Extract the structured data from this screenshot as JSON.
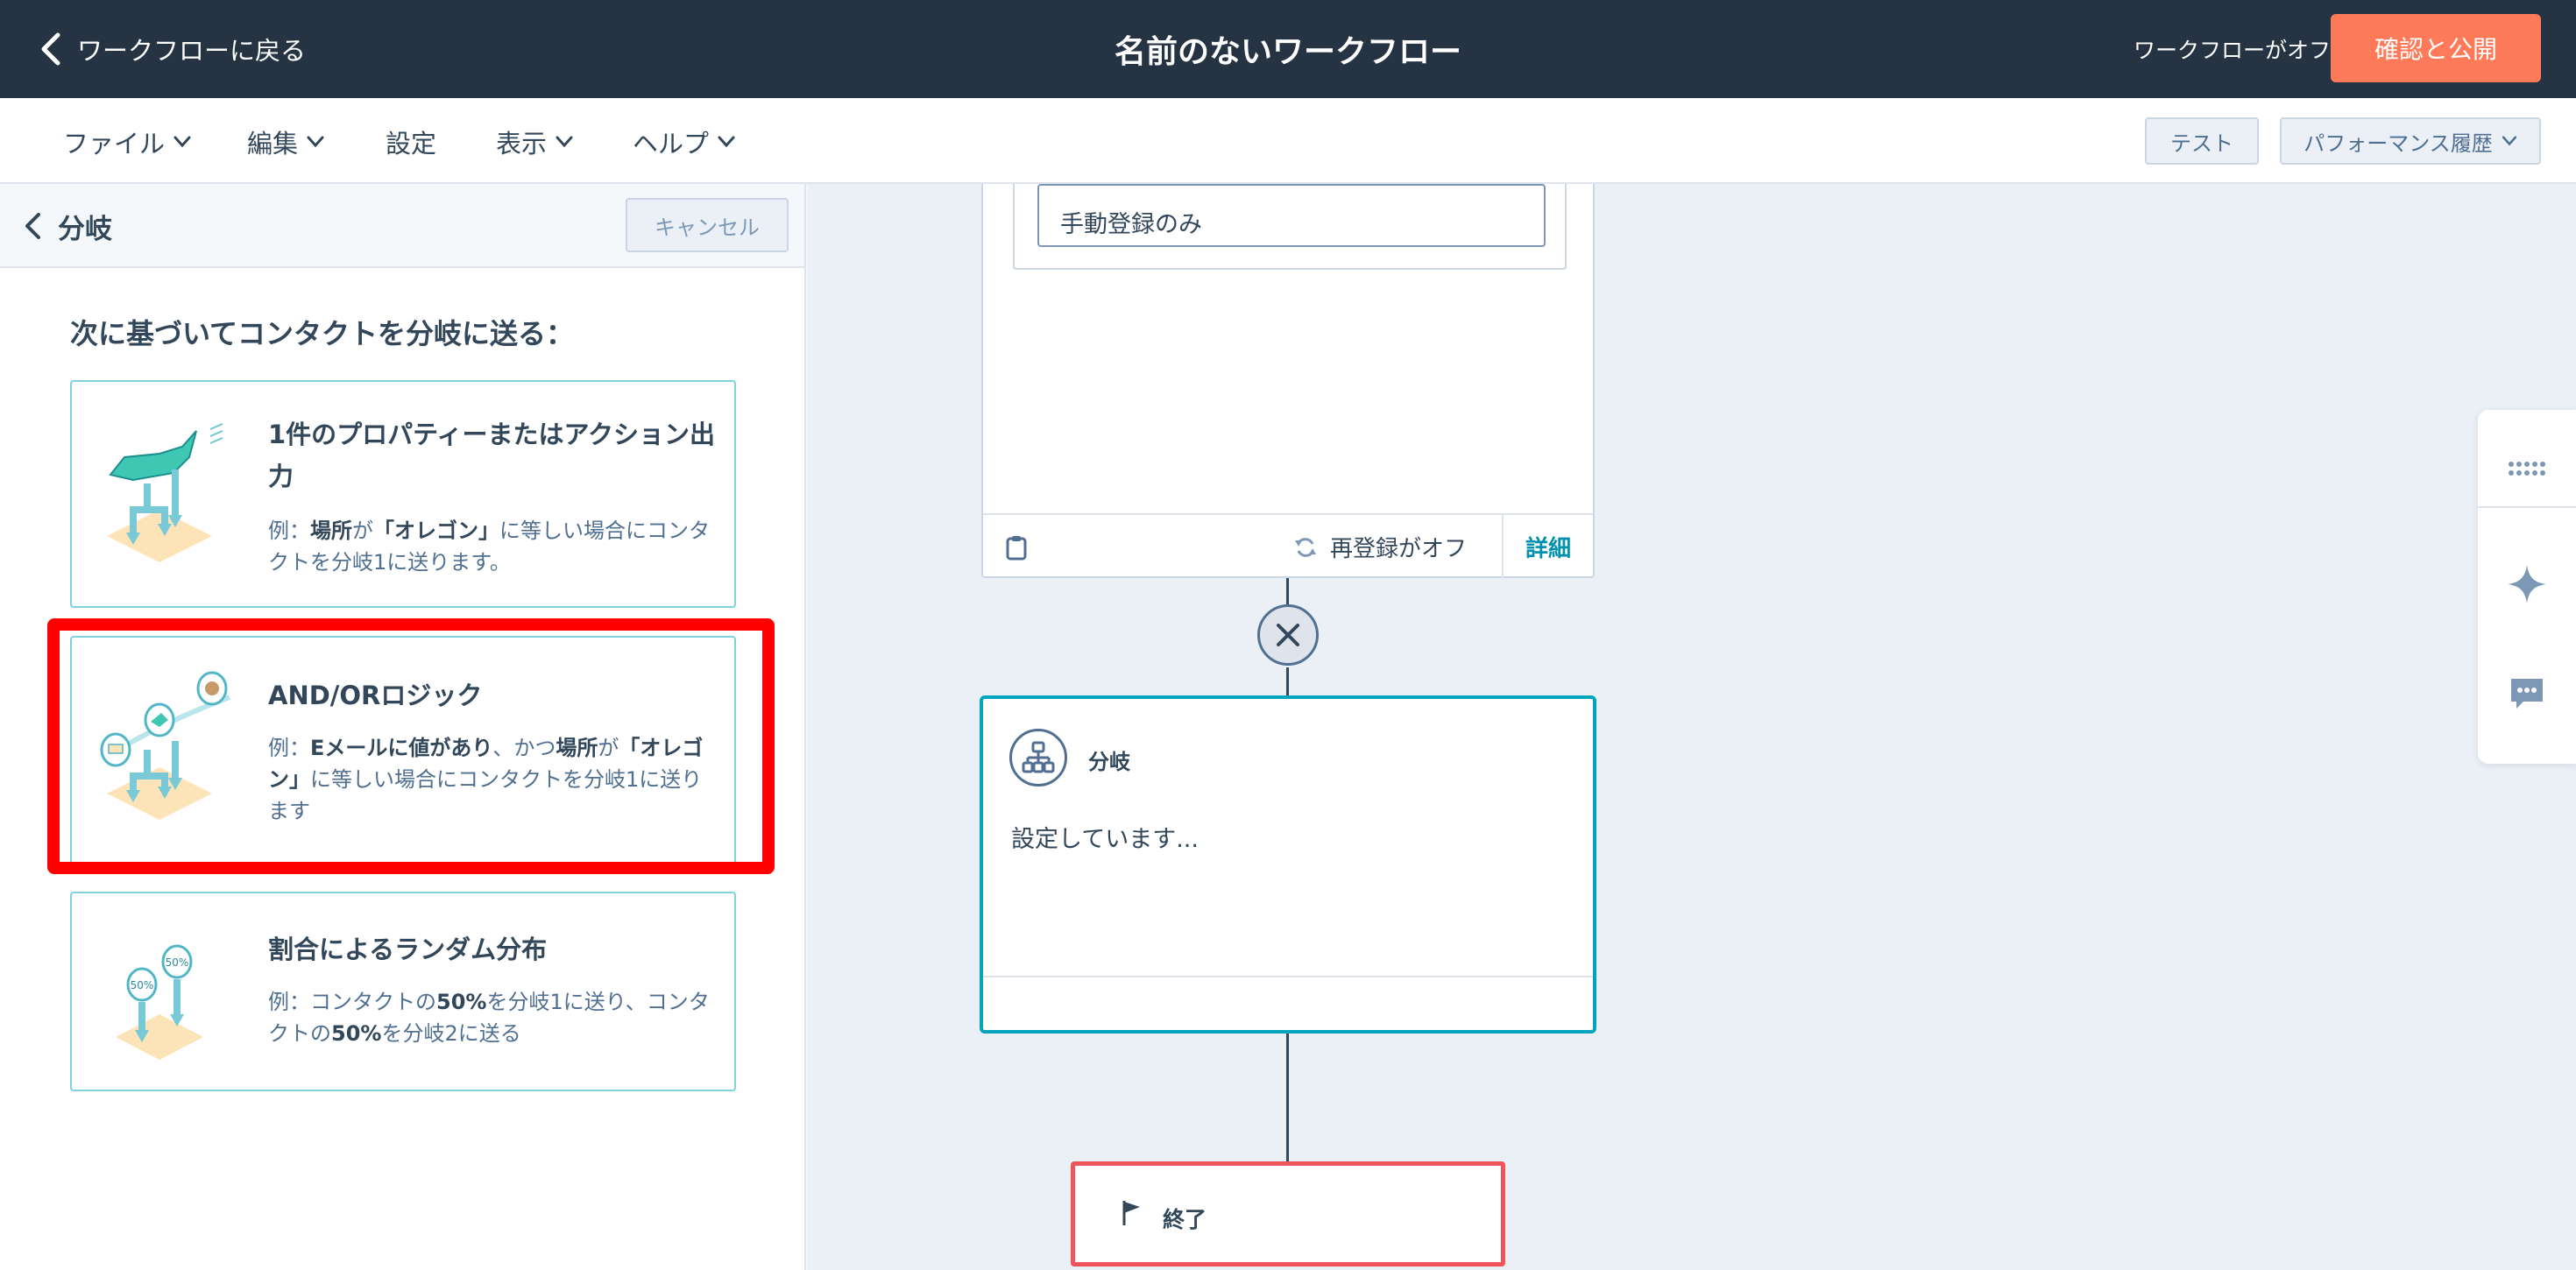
{
  "topbar": {
    "back_label": "ワークフローに戻る",
    "title": "名前のないワークフロー",
    "status": "ワークフローがオフ",
    "publish_label": "確認と公開"
  },
  "menu": {
    "items": [
      "ファイル",
      "編集",
      "設定",
      "表示",
      "ヘルプ"
    ],
    "test_label": "テスト",
    "history_label": "パフォーマンス履歴"
  },
  "panel": {
    "title": "分岐",
    "cancel_label": "キャンセル",
    "subtitle": "次に基づいてコンタクトを分岐に送る：",
    "options": [
      {
        "title": "1件のプロパティーまたはアクション出力",
        "desc_prefix": "例：",
        "desc_b1": "場所",
        "desc_mid1": "が",
        "desc_b2": "「オレゴン」",
        "desc_rest": "に等しい場合にコンタクトを分岐1に送ります。"
      },
      {
        "title": "AND/ORロジック",
        "desc_prefix": "例：",
        "desc_b1": "Eメールに値があり",
        "desc_mid1": "、かつ",
        "desc_b2": "場所",
        "desc_mid2": "が",
        "desc_b3": "「オレゴン」",
        "desc_rest": "に等しい場合にコンタクトを分岐1に送ります"
      },
      {
        "title": "割合によるランダム分布",
        "desc_prefix": "例：コンタクトの",
        "desc_b1": "50%",
        "desc_mid1": "を分岐1に送り、コンタクトの",
        "desc_b2": "50%",
        "desc_rest": "を分岐2に送る"
      }
    ]
  },
  "canvas": {
    "enroll_value": "手動登録のみ",
    "reenroll_label": "再登録がオフ",
    "detail_label": "詳細",
    "branch_label": "分岐",
    "branch_status": "設定しています...",
    "end_label": "終了"
  },
  "colors": {
    "topbar_bg": "#253342",
    "publish": "#ff7a59",
    "card_border": "#7fd1de",
    "branch_border": "#00a4bd",
    "end_border": "#f2545b",
    "highlight": "#ff0000"
  }
}
